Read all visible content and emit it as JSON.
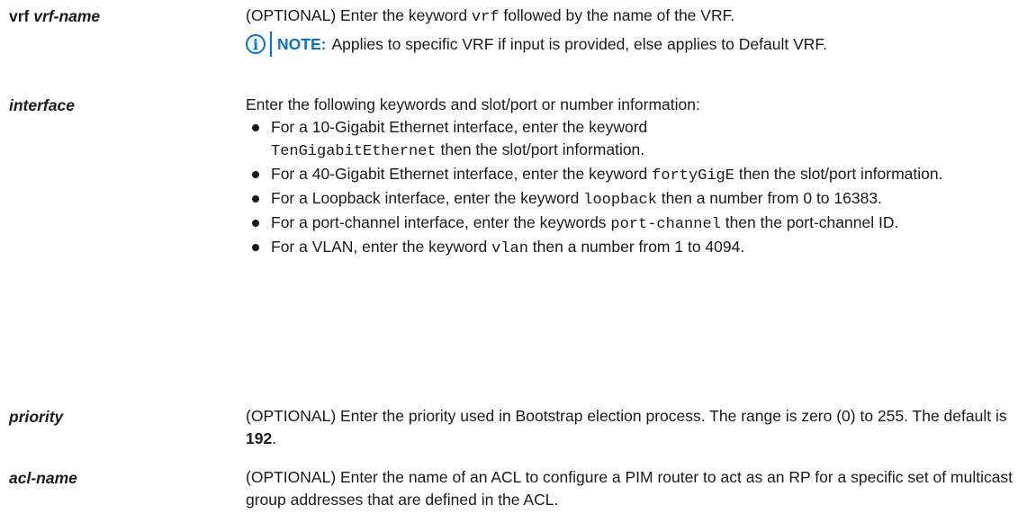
{
  "rows": [
    {
      "term_keyword": "vrf",
      "term_arg": "vrf-name",
      "desc_before": "(OPTIONAL) Enter the keyword ",
      "desc_code": "vrf",
      "desc_after": " followed by the name of the VRF.",
      "note": {
        "icon": "i",
        "label": "NOTE:",
        "text": "Applies to specific VRF if input is provided, else applies to Default VRF."
      }
    },
    {
      "term_arg": "interface",
      "intro": "Enter the following keywords and slot/port or number information:",
      "bullets": [
        {
          "before": "For a 10-Gigabit Ethernet interface, enter the keyword ",
          "code": "TenGigabitEthernet",
          "after": " then the slot/port information."
        },
        {
          "before": "For a 40-Gigabit Ethernet interface, enter the keyword ",
          "code": "fortyGigE",
          "after": " then the slot/port information."
        },
        {
          "before": "For a Loopback interface, enter the keyword ",
          "code": "loopback",
          "after": " then a number from 0 to 16383."
        },
        {
          "before": "For a port-channel interface, enter the keywords ",
          "code": "port-channel",
          "after": " then the port-channel ID."
        },
        {
          "before": "For a VLAN, enter the keyword ",
          "code": "vlan",
          "after": " then a number from 1 to 4094."
        }
      ]
    },
    {
      "term_arg": "priority",
      "desc_before": "(OPTIONAL) Enter the priority used in Bootstrap election process. The range is zero (0) to 255. The default is ",
      "desc_bold": "192",
      "desc_after": "."
    },
    {
      "term_arg": "acl-name",
      "desc": "(OPTIONAL) Enter the name of an ACL to configure a PIM router to act as an RP for a specific set of multicast group addresses that are defined in the ACL."
    }
  ]
}
